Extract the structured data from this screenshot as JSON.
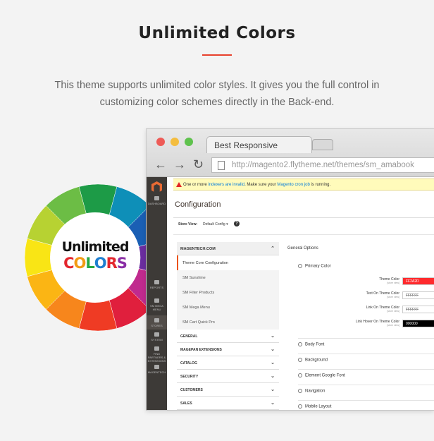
{
  "header": {
    "title": "Unlimited Colors",
    "intro": "This theme supports unlimited color styles. It gives you the full control in customizing color schemes directly in the Back-end."
  },
  "badge": {
    "line1": "Unlimited",
    "line2_letters": [
      {
        "ch": "C",
        "color": "#e3262d"
      },
      {
        "ch": "O",
        "color": "#f29b12"
      },
      {
        "ch": "L",
        "color": "#27a844"
      },
      {
        "ch": "O",
        "color": "#1e7fd0"
      },
      {
        "ch": "R",
        "color": "#e3262d"
      },
      {
        "ch": "S",
        "color": "#8b2fa6"
      }
    ],
    "wheel_colors": [
      "#1d9b47",
      "#0e8fb8",
      "#1a5fb4",
      "#6a2d9f",
      "#c02a8e",
      "#e01f3d",
      "#ef3b24",
      "#f7861c",
      "#fbb514",
      "#f9e515",
      "#b7d232",
      "#6cbd45"
    ]
  },
  "browser": {
    "tab_title": "Best Responsive",
    "url": "http://magento2.flytheme.net/themes/sm_amabook",
    "dot_colors": [
      "#ee5b57",
      "#f4bd3f",
      "#5fc24d"
    ]
  },
  "sidebar": {
    "items": [
      {
        "label": "DASHBOARD",
        "active": false
      },
      {
        "label": "REPORTS",
        "active": false
      },
      {
        "label": "SM MEGA MENU",
        "active": false
      },
      {
        "label": "STORES",
        "active": true
      },
      {
        "label": "SYSTEM",
        "active": false
      },
      {
        "label": "FIND PARTNERS & EXTENSIONS",
        "active": false
      },
      {
        "label": "MAGENTECH",
        "active": false
      }
    ]
  },
  "admin": {
    "notice_prefix": "One or more ",
    "notice_link1": "indexers are invalid",
    "notice_mid": ". Make sure your ",
    "notice_link2": "Magento cron job",
    "notice_suffix": " is running.",
    "page_title": "Configuration",
    "store_view_label": "Store View:",
    "store_view_value": "Default Config",
    "help": "?",
    "nav_head": "MAGENTECH.COM",
    "nav_subs": [
      {
        "label": "Theme Core Configuration",
        "active": true
      },
      {
        "label": "SM Sunshine",
        "active": false
      },
      {
        "label": "SM Filter Products",
        "active": false
      },
      {
        "label": "SM Mega Menu",
        "active": false
      },
      {
        "label": "SM Cart Quick Pro",
        "active": false
      }
    ],
    "nav_groups": [
      "GENERAL",
      "MAGEPAN EXTENSIONS",
      "CATALOG",
      "SECURITY",
      "CUSTOMERS",
      "SALES"
    ],
    "general_options": "General Options",
    "primary_color": "Primary Color",
    "fields": [
      {
        "label": "Theme Color",
        "scope": "[store view]",
        "value": "FF2A2D",
        "bg": "#ff2a2d",
        "fg": "#ffffff"
      },
      {
        "label": "Text On Theme Color",
        "scope": "[store view]",
        "value": "FFFFFF",
        "bg": "#ffffff",
        "fg": "#333333"
      },
      {
        "label": "Link On Theme Color",
        "scope": "[store view]",
        "value": "FFFFFF",
        "bg": "#ffffff",
        "fg": "#333333"
      },
      {
        "label": "Link Hover On Theme Color",
        "scope": "[store view]",
        "value": "000000",
        "bg": "#000000",
        "fg": "#ffffff"
      }
    ],
    "sections": [
      "Body Font",
      "Background",
      "Element Google Font",
      "Navigation",
      "Mobile Layout"
    ]
  },
  "colors": {
    "accent": "#e8412c",
    "magento_orange": "#eb5202"
  }
}
